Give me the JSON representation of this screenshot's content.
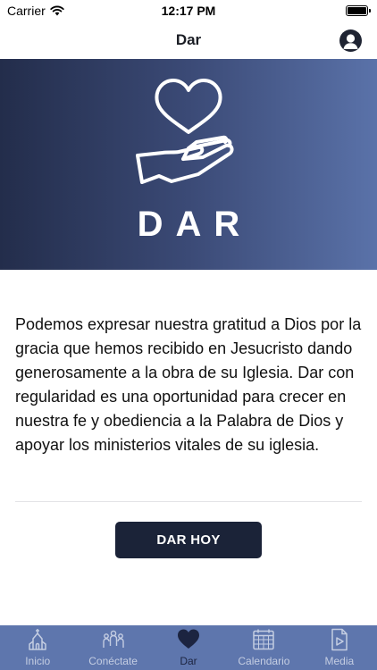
{
  "status_bar": {
    "carrier": "Carrier",
    "time": "12:17 PM",
    "battery_level": 1.0
  },
  "nav": {
    "title": "Dar"
  },
  "hero": {
    "title": "DAR",
    "icon": "heart-hand-icon"
  },
  "content": {
    "body": "Podemos expresar nuestra gratitud a Dios por la gracia que hemos recibido en Jesucristo dando generosamente a la obra de su Iglesia. Dar con regularidad es una oportunidad para crecer en nuestra fe y obediencia a la Palabra de Dios y apoyar los ministerios vitales de su iglesia.",
    "button_label": "DAR HOY"
  },
  "tabs": [
    {
      "label": "Inicio",
      "icon": "church-icon",
      "active": false
    },
    {
      "label": "Conéctate",
      "icon": "people-icon",
      "active": false
    },
    {
      "label": "Dar",
      "icon": "heart-icon",
      "active": true
    },
    {
      "label": "Calendario",
      "icon": "calendar-icon",
      "active": false
    },
    {
      "label": "Media",
      "icon": "media-icon",
      "active": false
    }
  ],
  "colors": {
    "tab_bar": "#5e76ad",
    "tab_active": "#1c2440",
    "tab_inactive": "#c4cde2",
    "button": "#1b2338",
    "hero_gradient_start": "#232d4b",
    "hero_gradient_end": "#5a72a9"
  }
}
